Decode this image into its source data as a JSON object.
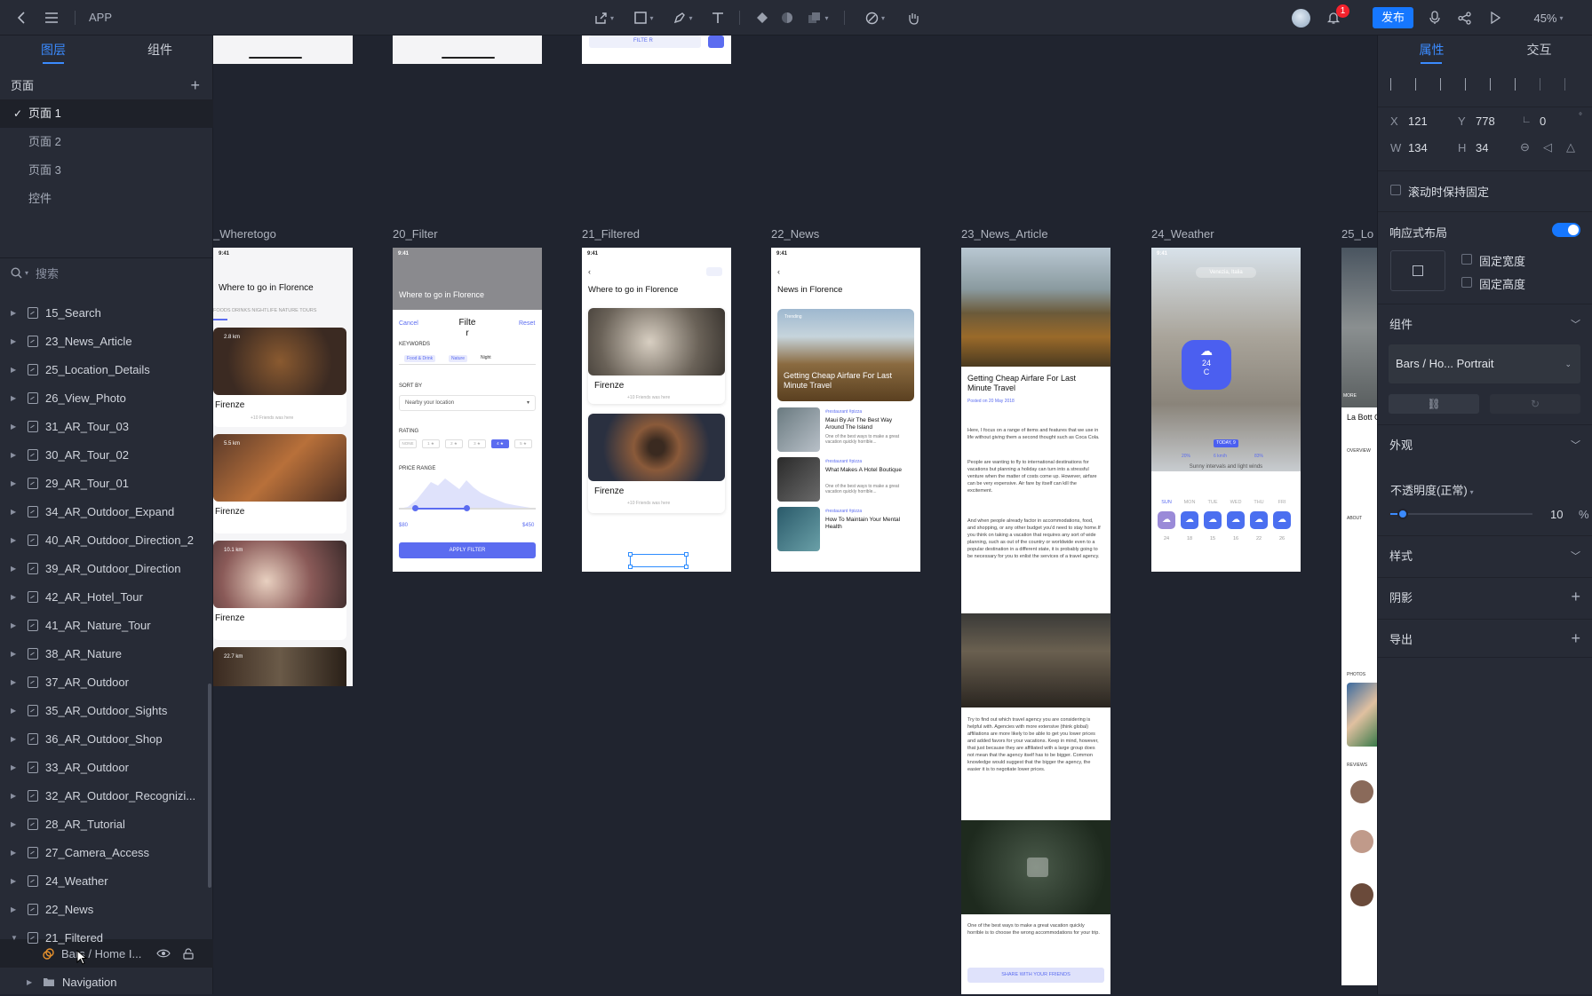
{
  "topbar": {
    "title": "APP",
    "publish": "发布",
    "notifications": "1",
    "zoom": "45%",
    "icons": [
      "back-arrow-icon",
      "menu-icon",
      "export-icon",
      "rectangle-tool-icon",
      "pen-tool-icon",
      "text-tool-icon",
      "component-icon",
      "mask-icon",
      "boolean-icon",
      "interaction-icon",
      "hand-tool-icon",
      "bell-icon",
      "mic-icon",
      "share-icon",
      "play-icon"
    ]
  },
  "left_panel": {
    "tabs": [
      "图层",
      "组件"
    ],
    "pages_header": "页面",
    "pages": [
      "页面 1",
      "页面 2",
      "页面 3",
      "控件"
    ],
    "search_placeholder": "搜索",
    "layers": [
      "15_Search",
      "23_News_Article",
      "25_Location_Details",
      "26_View_Photo",
      "31_AR_Tour_03",
      "30_AR_Tour_02",
      "29_AR_Tour_01",
      "34_AR_Outdoor_Expand",
      "40_AR_Outdoor_Direction_2",
      "39_AR_Outdoor_Direction",
      "42_AR_Hotel_Tour",
      "41_AR_Nature_Tour",
      "38_AR_Nature",
      "37_AR_Outdoor",
      "35_AR_Outdoor_Sights",
      "36_AR_Outdoor_Shop",
      "33_AR_Outdoor",
      "32_AR_Outdoor_Recognizi...",
      "28_AR_Tutorial",
      "27_Camera_Access",
      "24_Weather",
      "22_News",
      "21_Filtered"
    ],
    "child_layer": "Bars / Home I...",
    "child_folder": "Navigation"
  },
  "canvas": {
    "artboards": [
      "_Wheretogo",
      "20_Filter",
      "21_Filtered",
      "22_News",
      "23_News_Article",
      "24_Weather",
      "25_Lo"
    ],
    "wheretogo": {
      "title": "Where to go in Florence",
      "categories": "FOODS   DRINKS   NIGHTLIFE   NATURE   TOURS",
      "cards": [
        "Firenze",
        "Firenze",
        "Firenze"
      ],
      "distances": [
        "2.8 km",
        "5.5 km",
        "10.1 km",
        "22.7 km"
      ],
      "friends": "+10 Friends was here"
    },
    "filter": {
      "cancel": "Cancel",
      "title": "Filte r",
      "reset": "Reset",
      "keywords": "KEYWORDS",
      "tags": [
        "Food & Drink",
        "Nature",
        "Night"
      ],
      "sort_by": "SORT BY",
      "sort_value": "Nearby your location",
      "rating": "RATING",
      "ratings": [
        "NONE",
        "1 ★",
        "2 ★",
        "3 ★",
        "4 ★",
        "5 ★"
      ],
      "price_range": "PRICE RANGE",
      "min": "$80",
      "max": "$450",
      "apply": "APPLY FILTER"
    },
    "filtered": {
      "title": "Where to go in Florence",
      "cards": [
        "Firenze",
        "Firenze"
      ],
      "friends": "+10 Friends was here"
    },
    "news": {
      "title": "News in Florence",
      "hero_tag": "Trending",
      "hero_title": "Getting Cheap Airfare For Last Minute Travel",
      "items": [
        "Maui By Air The Best Way Around The Island",
        "What Makes A Hotel Boutique",
        "How To Maintain Your Mental Health"
      ],
      "item_tags": "#restaurant  #pizza",
      "item_desc": "One of the best ways to make a great vacation quickly horrible..."
    },
    "article": {
      "title": "Getting Cheap Airfare For Last Minute Travel",
      "date": "Posted on 20 May 2018",
      "p1": "Here, I focus on a range of items and features that we use in life without giving them a second thought such as Coca Cola.",
      "p2": "People are wanting to fly to international destinations for vacations but planning a holiday can turn into a stressful venture when the matter of costs come up. However, airfare can be very expensive. Air fare by itself can kill the excitement.",
      "p3": "And when people already factor in accommodations, food, and shopping, or any other budget you'd need to stay home.If you think on taking a vacation that requires any sort of wide planning, such as out of the country or worldwide even to a popular destination in a different state, it is probably going to be necessary for you to enlist the services of a travel agency.",
      "p4": "Try to find out which travel agency you are considering is helpful with. Agencies with more extensive (think global) affiliations are more likely to be able to get you lower prices and added favors for your vacations. Keep in mind, however, that just because they are affiliated with a large group does not mean that the agency itself has to be bigger. Common knowledge would suggest that the bigger the agency, the easier it is to negotiate lower prices.",
      "p5": "One of the best ways to make a great vacation quickly horrible is to choose the wrong accommodations for your trip.",
      "share": "SHARE WITH YOUR FRIENDS"
    },
    "weather": {
      "location": "Venezia, Italia",
      "temp": "24",
      "unit": "C",
      "today": "TODAY, 9",
      "stats": [
        "20%",
        "6 km/h",
        "83%"
      ],
      "desc": "Sunny intervals and light winds",
      "days": [
        "SUN",
        "MON",
        "TUE",
        "WED",
        "THU",
        "FRI"
      ],
      "temps": [
        "24",
        "18",
        "15",
        "16",
        "22",
        "26"
      ]
    },
    "location": {
      "title": "La Bott Caffe",
      "overview": "OVERVIEW",
      "about": "ABOUT",
      "photos": "PHOTOS",
      "reviews": "REVIEWS",
      "more": "MORE"
    }
  },
  "right_panel": {
    "tabs": [
      "属性",
      "交互"
    ],
    "x_label": "X",
    "x": "121",
    "y_label": "Y",
    "y": "778",
    "angle": "0",
    "w_label": "W",
    "w": "134",
    "h_label": "H",
    "h": "34",
    "fixed_on_scroll": "滚动时保持固定",
    "responsive": "响应式布局",
    "fixed_width": "固定宽度",
    "fixed_height": "固定高度",
    "component": "组件",
    "component_name": "Bars / Ho... Portrait",
    "appearance": "外观",
    "opacity_label": "不透明度(正常)",
    "opacity": "10",
    "percent": "%",
    "style": "样式",
    "shadow": "阴影",
    "export": "导出"
  }
}
